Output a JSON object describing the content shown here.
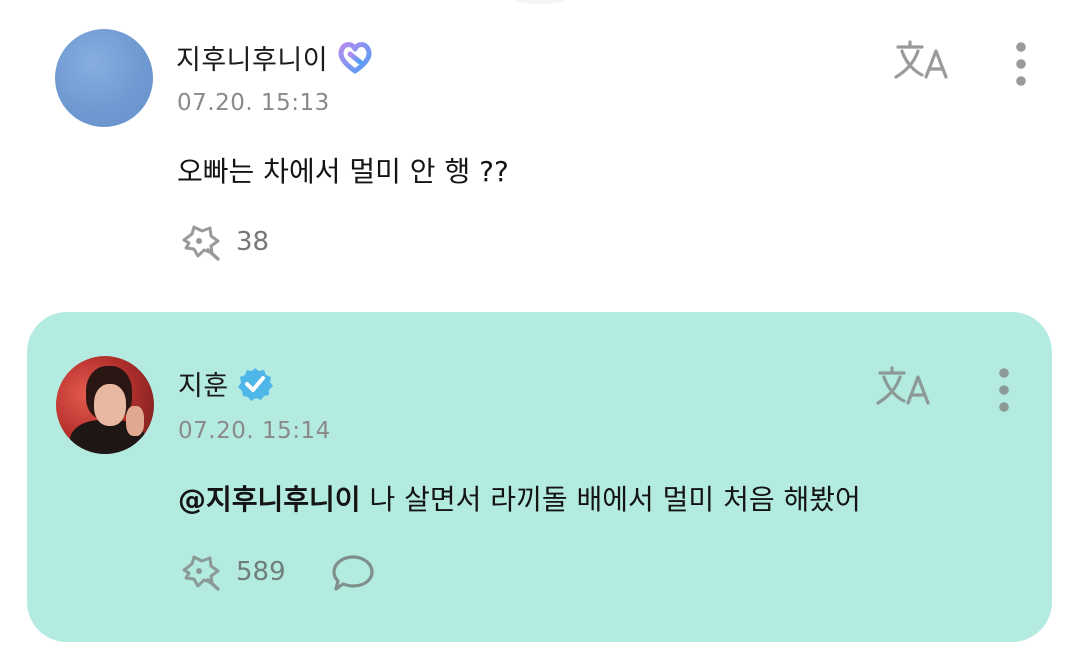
{
  "comments": [
    {
      "username": "지후니후니이",
      "timestamp": "07.20. 15:13",
      "text": "오빠는 차에서 멀미 안 행 ??",
      "likes": "38",
      "badge_icon": "heart-badge-icon"
    }
  ],
  "reply": {
    "username": "지훈",
    "timestamp": "07.20. 15:14",
    "mention": "@지후니후니이",
    "text": "나 살면서 라끼돌 배에서 멀미 처음 해봤어",
    "likes": "589",
    "badge_icon": "verified-badge-icon",
    "background": "#b4ebe1"
  },
  "colors": {
    "badge_purple": "#a98af0",
    "badge_blue": "#5aa7f4",
    "verified": "#4fb7e8",
    "icon_gray": "#9a9a9a"
  }
}
